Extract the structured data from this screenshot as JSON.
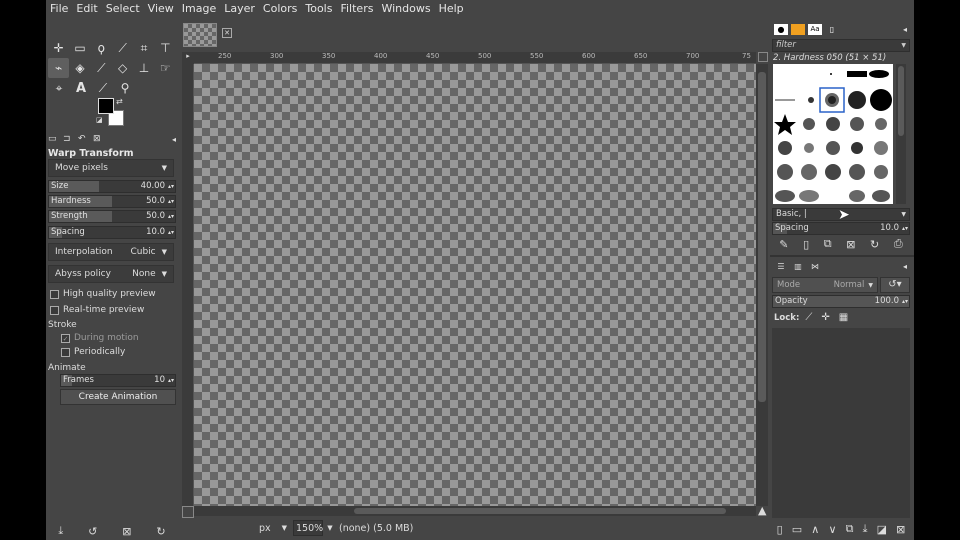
{
  "menu": [
    "File",
    "Edit",
    "Select",
    "View",
    "Image",
    "Layer",
    "Colors",
    "Tools",
    "Filters",
    "Windows",
    "Help"
  ],
  "tool_options": {
    "title": "Warp Transform",
    "mode": "Move pixels",
    "size": {
      "label": "Size",
      "value": "40.00",
      "fraction": 0.4
    },
    "hardness": {
      "label": "Hardness",
      "value": "50.0",
      "fraction": 0.5
    },
    "strength": {
      "label": "Strength",
      "value": "50.0",
      "fraction": 0.5
    },
    "spacing": {
      "label": "Spacing",
      "value": "10.0",
      "fraction": 0.1
    },
    "interpolation": {
      "label": "Interpolation",
      "value": "Cubic"
    },
    "abyss": {
      "label": "Abyss policy",
      "value": "None"
    },
    "hq_preview": "High quality preview",
    "rt_preview": "Real-time preview",
    "stroke_label": "Stroke",
    "during_motion": "During motion",
    "periodically": "Periodically",
    "animate_label": "Animate",
    "frames": {
      "label": "Frames",
      "value": "10",
      "fraction": 0.1
    },
    "create_animation": "Create Animation"
  },
  "ruler_ticks": [
    "250",
    "300",
    "350",
    "400",
    "450",
    "500",
    "550",
    "600",
    "650",
    "700",
    "75"
  ],
  "status": {
    "unit": "px",
    "zoom": "150%",
    "text": "(none) (5.0 MB)"
  },
  "brushes": {
    "filter_placeholder": "filter",
    "current": "2. Hardness 050 (51 × 51)",
    "tag": "Basic, |",
    "spacing": {
      "label": "Spacing",
      "value": "10.0",
      "fraction": 0.1
    }
  },
  "layers": {
    "mode_label": "Mode",
    "mode_value": "Normal",
    "opacity": {
      "label": "Opacity",
      "value": "100.0",
      "fraction": 1.0
    },
    "lock_label": "Lock:"
  }
}
